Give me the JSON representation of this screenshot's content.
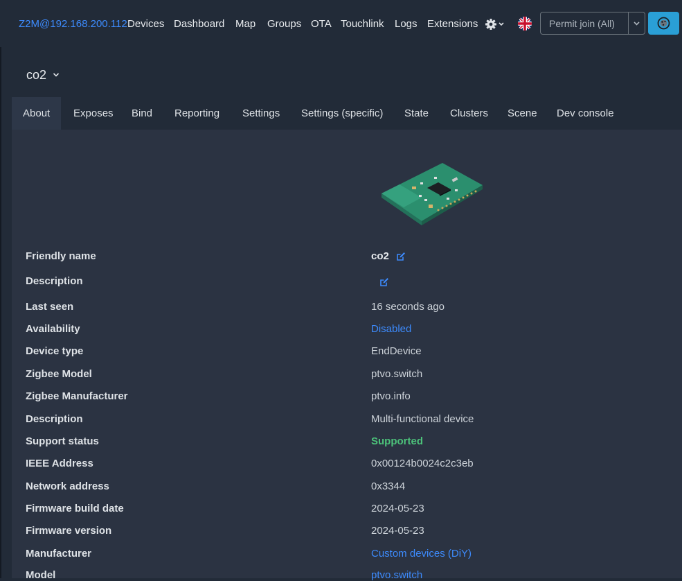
{
  "navbar": {
    "brand": "Z2M@192.168.200.112",
    "items": [
      "Devices",
      "Dashboard",
      "Map",
      "Groups",
      "OTA",
      "Touchlink",
      "Logs",
      "Extensions"
    ],
    "settings_icon": "gear-icon",
    "language_icon": "uk-flag-icon",
    "permit_join_label": "Permit join (All)",
    "theme_icon": "theme-toggle-icon"
  },
  "device": {
    "name": "co2"
  },
  "tabs": [
    "About",
    "Exposes",
    "Bind",
    "Reporting",
    "Settings",
    "Settings (specific)",
    "State",
    "Clusters",
    "Scene",
    "Dev console"
  ],
  "active_tab": "About",
  "properties": [
    {
      "label": "Friendly name",
      "value": "co2"
    },
    {
      "label": "Description",
      "value": ""
    },
    {
      "label": "Last seen",
      "value": "16 seconds ago"
    },
    {
      "label": "Availability",
      "value": "Disabled"
    },
    {
      "label": "Device type",
      "value": "EndDevice"
    },
    {
      "label": "Zigbee Model",
      "value": "ptvo.switch"
    },
    {
      "label": "Zigbee Manufacturer",
      "value": "ptvo.info"
    },
    {
      "label": "Description",
      "value": "Multi-functional device"
    },
    {
      "label": "Support status",
      "value": "Supported"
    },
    {
      "label": "IEEE Address",
      "value": "0x00124b0024c2c3eb"
    },
    {
      "label": "Network address",
      "value": "0x3344"
    },
    {
      "label": "Firmware build date",
      "value": "2024-05-23"
    },
    {
      "label": "Firmware version",
      "value": "2024-05-23"
    },
    {
      "label": "Manufacturer",
      "value": "Custom devices (DiY)"
    },
    {
      "label": "Model",
      "value": "ptvo.switch"
    }
  ],
  "colors": {
    "background": "#222b38",
    "panel": "#2b3342",
    "link": "#3d8bfd",
    "success": "#4cc27a",
    "primary_button": "#2a9fd6"
  }
}
